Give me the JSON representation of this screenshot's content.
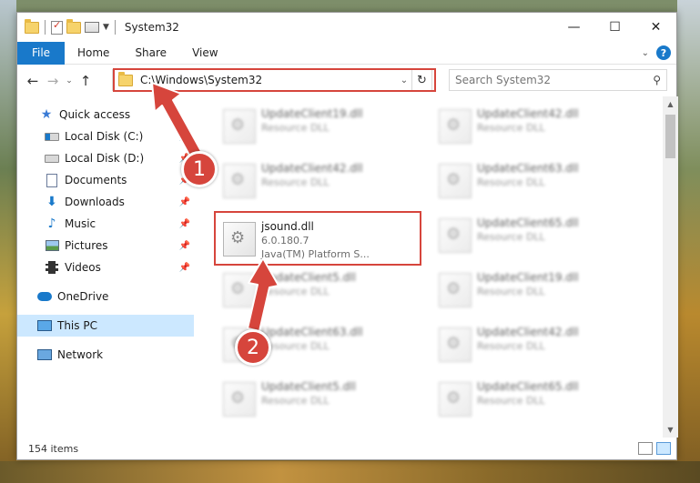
{
  "window": {
    "title": "System32"
  },
  "ribbon": {
    "tabs": [
      "File",
      "Home",
      "Share",
      "View"
    ],
    "help": "?"
  },
  "nav": {
    "address": "C:\\Windows\\System32",
    "search_placeholder": "Search System32"
  },
  "sidebar": {
    "quick_access": "Quick access",
    "items": [
      {
        "label": "Local Disk (C:)",
        "icon": "drive-icon"
      },
      {
        "label": "Local Disk (D:)",
        "icon": "drive-icon"
      },
      {
        "label": "Documents",
        "icon": "documents-icon"
      },
      {
        "label": "Downloads",
        "icon": "downloads-icon"
      },
      {
        "label": "Music",
        "icon": "music-icon"
      },
      {
        "label": "Pictures",
        "icon": "pictures-icon"
      },
      {
        "label": "Videos",
        "icon": "videos-icon"
      }
    ],
    "onedrive": "OneDrive",
    "this_pc": "This PC",
    "network": "Network"
  },
  "files": [
    {
      "name": "UpdateClient19.dll",
      "desc": "Resource DLL",
      "sub": ""
    },
    {
      "name": "UpdateClient42.dll",
      "desc": "Resource DLL",
      "sub": ""
    },
    {
      "name": "UpdateClient42.dll",
      "desc": "Resource DLL",
      "sub": ""
    },
    {
      "name": "UpdateClient63.dll",
      "desc": "Resource DLL",
      "sub": ""
    },
    {
      "name": "jsound.dll",
      "desc": "6.0.180.7",
      "sub": "Java(TM) Platform S..."
    },
    {
      "name": "UpdateClient65.dll",
      "desc": "Resource DLL",
      "sub": ""
    },
    {
      "name": "UpdateClient5.dll",
      "desc": "Resource DLL",
      "sub": ""
    },
    {
      "name": "UpdateClient19.dll",
      "desc": "Resource DLL",
      "sub": ""
    },
    {
      "name": "UpdateClient63.dll",
      "desc": "Resource DLL",
      "sub": ""
    },
    {
      "name": "UpdateClient42.dll",
      "desc": "Resource DLL",
      "sub": ""
    },
    {
      "name": "UpdateClient5.dll",
      "desc": "Resource DLL",
      "sub": ""
    },
    {
      "name": "UpdateClient65.dll",
      "desc": "Resource DLL",
      "sub": ""
    }
  ],
  "status": {
    "count": "154 items"
  },
  "annotations": {
    "step1": "1",
    "step2": "2",
    "color": "#d6453c"
  }
}
